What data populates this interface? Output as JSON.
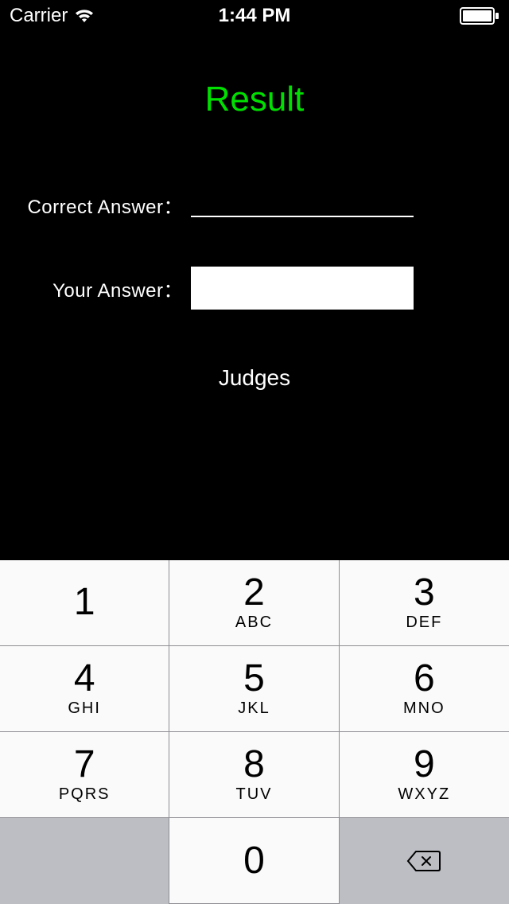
{
  "statusBar": {
    "carrier": "Carrier",
    "time": "1:44 PM"
  },
  "title": "Result",
  "labels": {
    "correctAnswer": "Correct Answer：",
    "yourAnswer": "Your Answer："
  },
  "fields": {
    "correctAnswer": "",
    "yourAnswer": ""
  },
  "buttons": {
    "judges": "Judges"
  },
  "keypad": {
    "keys": [
      {
        "digit": "1",
        "letters": ""
      },
      {
        "digit": "2",
        "letters": "ABC"
      },
      {
        "digit": "3",
        "letters": "DEF"
      },
      {
        "digit": "4",
        "letters": "GHI"
      },
      {
        "digit": "5",
        "letters": "JKL"
      },
      {
        "digit": "6",
        "letters": "MNO"
      },
      {
        "digit": "7",
        "letters": "PQRS"
      },
      {
        "digit": "8",
        "letters": "TUV"
      },
      {
        "digit": "9",
        "letters": "WXYZ"
      },
      {
        "digit": "0",
        "letters": ""
      }
    ]
  }
}
